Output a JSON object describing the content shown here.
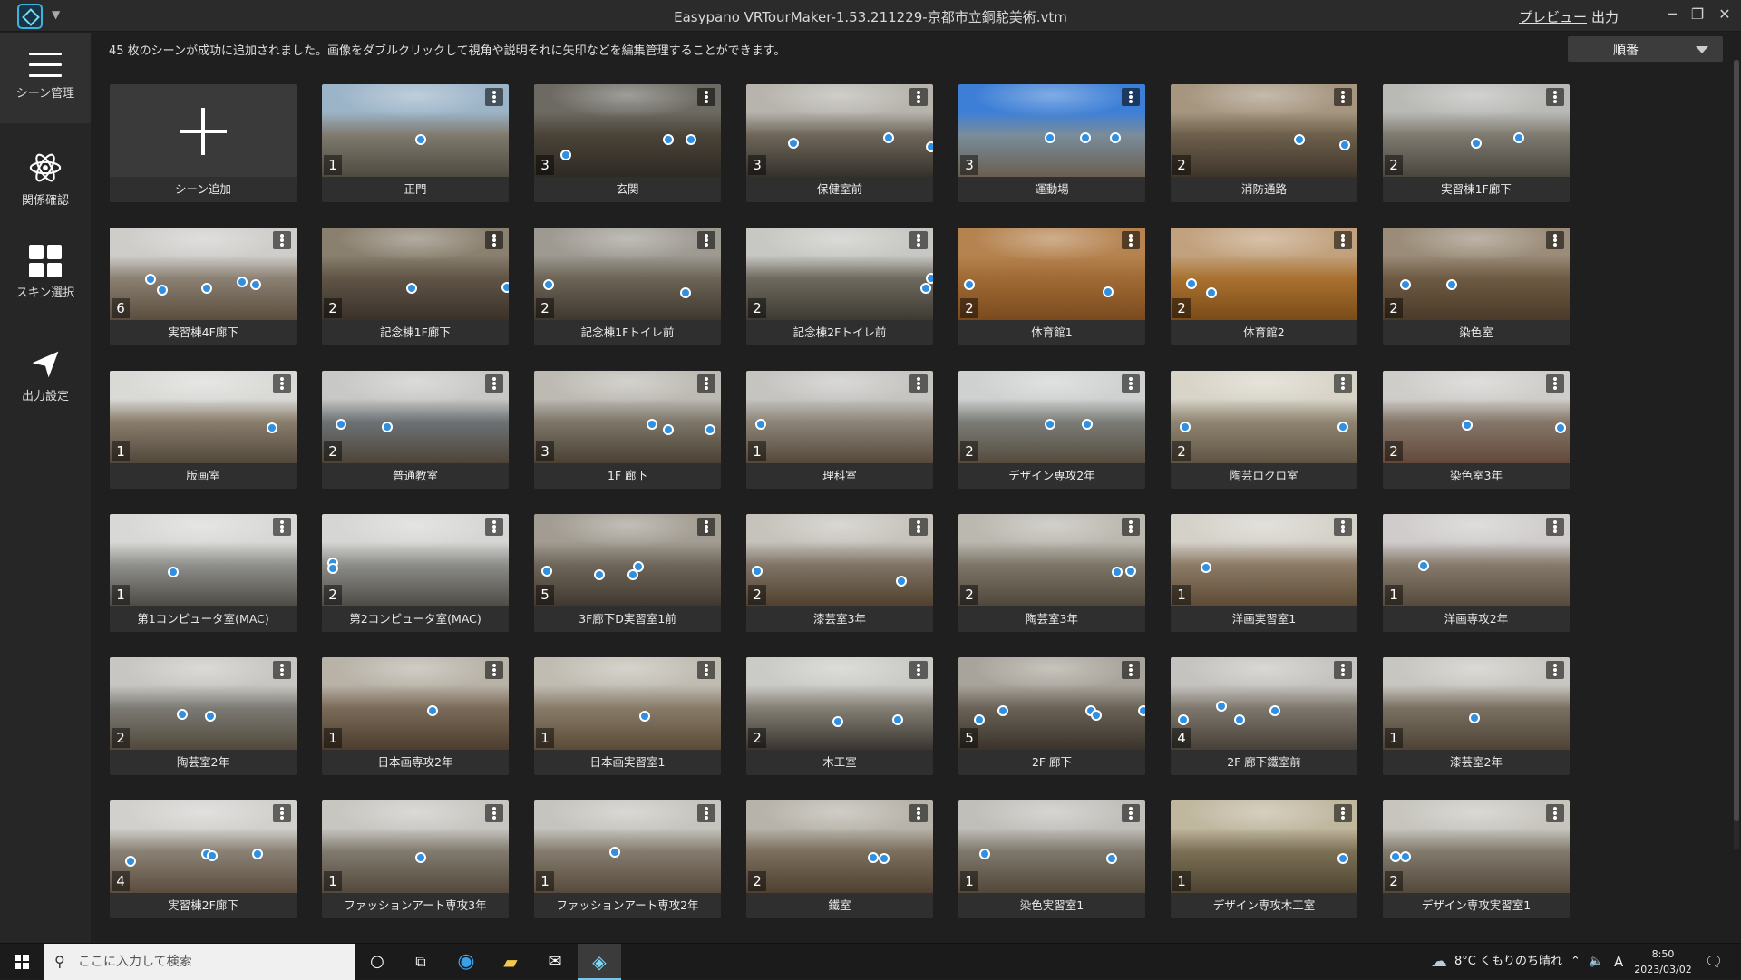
{
  "window": {
    "title": "Easypano VRTourMaker-1.53.211229-京都市立銅駝美術.vtm",
    "preview_link": "プレビュー",
    "output_link": "出力",
    "minimize": "─",
    "restore": "❐",
    "close": "✕"
  },
  "sidebar": {
    "items": [
      {
        "label": "シーン管理",
        "icon": "hamburger-icon"
      },
      {
        "label": "関係確認",
        "icon": "atom-icon"
      },
      {
        "label": "スキン選択",
        "icon": "grid-icon"
      },
      {
        "label": "出力設定",
        "icon": "send-arrow-icon"
      }
    ]
  },
  "main": {
    "message": "45 枚のシーンが成功に追加されました。画像をダブルクリックして視角や説明それに矢印などを編集管理することができます。",
    "sort_label": "順番",
    "add_scene_label": "シーン追加"
  },
  "scenes": [
    {
      "name": "正門",
      "count": "1",
      "hotspots": [
        [
          0.53,
          0.6
        ]
      ],
      "colors": [
        "#9cb4c8",
        "#7f7a6e",
        "#4f4a40"
      ]
    },
    {
      "name": "玄関",
      "count": "3",
      "hotspots": [
        [
          0.17,
          0.76
        ],
        [
          0.72,
          0.6
        ],
        [
          0.84,
          0.6
        ]
      ],
      "colors": [
        "#6d6a63",
        "#4a4338",
        "#2e2a24"
      ]
    },
    {
      "name": "保健室前",
      "count": "3",
      "hotspots": [
        [
          0.25,
          0.64
        ],
        [
          0.76,
          0.58
        ],
        [
          0.99,
          0.68
        ]
      ],
      "colors": [
        "#b7b4ad",
        "#6e665a",
        "#35312b"
      ]
    },
    {
      "name": "運動場",
      "count": "3",
      "hotspots": [
        [
          0.49,
          0.58
        ],
        [
          0.68,
          0.58
        ],
        [
          0.84,
          0.58
        ]
      ],
      "colors": [
        "#3d7fd6",
        "#7a8c9a",
        "#6a5f50"
      ]
    },
    {
      "name": "消防通路",
      "count": "2",
      "hotspots": [
        [
          0.69,
          0.6
        ],
        [
          0.93,
          0.66
        ]
      ],
      "colors": [
        "#a69680",
        "#6d5f4b",
        "#3e352a"
      ]
    },
    {
      "name": "実習棟1F廊下",
      "count": "2",
      "hotspots": [
        [
          0.5,
          0.64
        ],
        [
          0.73,
          0.58
        ]
      ],
      "colors": [
        "#b9b9b6",
        "#7f7a70",
        "#4a453e"
      ]
    },
    {
      "name": "実習棟4F廊下",
      "count": "6",
      "hotspots": [
        [
          0.22,
          0.56
        ],
        [
          0.28,
          0.68
        ],
        [
          0.52,
          0.66
        ],
        [
          0.71,
          0.59
        ],
        [
          0.78,
          0.62
        ]
      ],
      "colors": [
        "#cfcdca",
        "#8b8072",
        "#5a4d3e"
      ]
    },
    {
      "name": "記念棟1F廊下",
      "count": "2",
      "hotspots": [
        [
          0.48,
          0.66
        ],
        [
          0.99,
          0.65
        ]
      ],
      "colors": [
        "#8a806f",
        "#5f5446",
        "#3a3129"
      ]
    },
    {
      "name": "記念棟1Fトイレ前",
      "count": "2",
      "hotspots": [
        [
          0.08,
          0.62
        ],
        [
          0.81,
          0.71
        ]
      ],
      "colors": [
        "#9e9a92",
        "#6c6455",
        "#3f382f"
      ]
    },
    {
      "name": "記念棟2Fトイレ前",
      "count": "2",
      "hotspots": [
        [
          0.96,
          0.66
        ],
        [
          0.99,
          0.55
        ]
      ],
      "colors": [
        "#c7c7c3",
        "#6f6a5e",
        "#3d3a33"
      ]
    },
    {
      "name": "体育館1",
      "count": "2",
      "hotspots": [
        [
          0.06,
          0.62
        ],
        [
          0.8,
          0.7
        ]
      ],
      "colors": [
        "#b58350",
        "#a06a34",
        "#7a4a1e"
      ]
    },
    {
      "name": "体育館2",
      "count": "2",
      "hotspots": [
        [
          0.11,
          0.61
        ],
        [
          0.22,
          0.71
        ]
      ],
      "colors": [
        "#c2a27e",
        "#a8712f",
        "#7b4b18"
      ]
    },
    {
      "name": "染色室",
      "count": "2",
      "hotspots": [
        [
          0.12,
          0.62
        ],
        [
          0.37,
          0.62
        ]
      ],
      "colors": [
        "#9a8c78",
        "#6e5a43",
        "#4a3a29"
      ]
    },
    {
      "name": "版画室",
      "count": "1",
      "hotspots": [
        [
          0.87,
          0.62
        ]
      ],
      "colors": [
        "#d9d9d6",
        "#8a7e6d",
        "#51473a"
      ]
    },
    {
      "name": "普通教室",
      "count": "2",
      "hotspots": [
        [
          0.1,
          0.58
        ],
        [
          0.35,
          0.61
        ]
      ],
      "colors": [
        "#c8c8c6",
        "#6d7275",
        "#4d4437"
      ]
    },
    {
      "name": "1F 廊下",
      "count": "3",
      "hotspots": [
        [
          0.63,
          0.58
        ],
        [
          0.72,
          0.64
        ],
        [
          0.94,
          0.64
        ]
      ],
      "colors": [
        "#bdbab3",
        "#7d7669",
        "#4a4034"
      ]
    },
    {
      "name": "理科室",
      "count": "1",
      "hotspots": [
        [
          0.08,
          0.58
        ]
      ],
      "colors": [
        "#c5c4c1",
        "#8d8579",
        "#54483a"
      ]
    },
    {
      "name": "デザイン専攻2年",
      "count": "2",
      "hotspots": [
        [
          0.49,
          0.58
        ],
        [
          0.69,
          0.58
        ]
      ],
      "colors": [
        "#cfd1d0",
        "#7b7d78",
        "#554b3d"
      ]
    },
    {
      "name": "陶芸ロクロ室",
      "count": "2",
      "hotspots": [
        [
          0.08,
          0.61
        ],
        [
          0.92,
          0.61
        ]
      ],
      "colors": [
        "#d8d4c8",
        "#8f8572",
        "#5f5443"
      ]
    },
    {
      "name": "染色室3年",
      "count": "2",
      "hotspots": [
        [
          0.45,
          0.59
        ],
        [
          0.95,
          0.62
        ]
      ],
      "colors": [
        "#cfcdca",
        "#85776a",
        "#62493a"
      ]
    },
    {
      "name": "第1コンピュータ室(MAC)",
      "count": "1",
      "hotspots": [
        [
          0.34,
          0.63
        ]
      ],
      "colors": [
        "#d8d8d6",
        "#8f8f8b",
        "#4d4a44"
      ]
    },
    {
      "name": "第2コンピュータ室(MAC)",
      "count": "2",
      "hotspots": [
        [
          0.06,
          0.53
        ],
        [
          0.06,
          0.59
        ]
      ],
      "colors": [
        "#d6d6d4",
        "#8c8c88",
        "#4e4b45"
      ]
    },
    {
      "name": "3F廊下D実習室1前",
      "count": "5",
      "hotspots": [
        [
          0.07,
          0.62
        ],
        [
          0.35,
          0.66
        ],
        [
          0.53,
          0.66
        ],
        [
          0.56,
          0.57
        ]
      ],
      "colors": [
        "#a29c92",
        "#6f665a",
        "#40382f"
      ]
    },
    {
      "name": "漆芸室3年",
      "count": "2",
      "hotspots": [
        [
          0.06,
          0.62
        ],
        [
          0.83,
          0.73
        ]
      ],
      "colors": [
        "#c6c3bc",
        "#7f7466",
        "#513f2e"
      ]
    },
    {
      "name": "陶芸室3年",
      "count": "2",
      "hotspots": [
        [
          0.85,
          0.63
        ],
        [
          0.92,
          0.62
        ]
      ],
      "colors": [
        "#bbb8b0",
        "#7d7668",
        "#4e463a"
      ]
    },
    {
      "name": "洋画実習室1",
      "count": "1",
      "hotspots": [
        [
          0.19,
          0.58
        ]
      ],
      "colors": [
        "#d4d1c9",
        "#8c7b66",
        "#5c4a35"
      ]
    },
    {
      "name": "洋画専攻2年",
      "count": "1",
      "hotspots": [
        [
          0.22,
          0.56
        ]
      ],
      "colors": [
        "#cfcccb",
        "#857a6c",
        "#55493c"
      ]
    },
    {
      "name": "陶芸室2年",
      "count": "2",
      "hotspots": [
        [
          0.39,
          0.62
        ],
        [
          0.54,
          0.64
        ]
      ],
      "colors": [
        "#c7c6c2",
        "#7b7a74",
        "#52483b"
      ]
    },
    {
      "name": "日本画専攻2年",
      "count": "1",
      "hotspots": [
        [
          0.59,
          0.58
        ]
      ],
      "colors": [
        "#b8b2a7",
        "#7a6a59",
        "#4d3d2e"
      ]
    },
    {
      "name": "日本画実習室1",
      "count": "1",
      "hotspots": [
        [
          0.59,
          0.64
        ]
      ],
      "colors": [
        "#c0bcb2",
        "#887b68",
        "#5a4b38"
      ]
    },
    {
      "name": "木工室",
      "count": "2",
      "hotspots": [
        [
          0.49,
          0.7
        ],
        [
          0.81,
          0.68
        ]
      ],
      "colors": [
        "#cacac6",
        "#847f75",
        "#3a3530"
      ]
    },
    {
      "name": "2F 廊下",
      "count": "5",
      "hotspots": [
        [
          0.11,
          0.68
        ],
        [
          0.24,
          0.58
        ],
        [
          0.71,
          0.58
        ],
        [
          0.74,
          0.63
        ],
        [
          0.99,
          0.58
        ]
      ],
      "colors": [
        "#a9a49b",
        "#6a6256",
        "#3a332b"
      ]
    },
    {
      "name": "2F 廊下鐵室前",
      "count": "4",
      "hotspots": [
        [
          0.07,
          0.68
        ],
        [
          0.27,
          0.53
        ],
        [
          0.37,
          0.68
        ],
        [
          0.56,
          0.58
        ]
      ],
      "colors": [
        "#c5c3bf",
        "#7e776d",
        "#464038"
      ]
    },
    {
      "name": "漆芸室2年",
      "count": "1",
      "hotspots": [
        [
          0.49,
          0.66
        ]
      ],
      "colors": [
        "#c8c6c0",
        "#7a7062",
        "#4e4335"
      ]
    },
    {
      "name": "実習棟2F廊下",
      "count": "4",
      "hotspots": [
        [
          0.11,
          0.66
        ],
        [
          0.52,
          0.58
        ],
        [
          0.55,
          0.6
        ],
        [
          0.79,
          0.58
        ]
      ],
      "colors": [
        "#d1d0cd",
        "#8a8175",
        "#5b4d3e"
      ]
    },
    {
      "name": "ファッションアート専攻3年",
      "count": "1",
      "hotspots": [
        [
          0.53,
          0.62
        ]
      ],
      "colors": [
        "#c7c6c1",
        "#817a6e",
        "#53493c"
      ]
    },
    {
      "name": "ファッションアート専攻2年",
      "count": "1",
      "hotspots": [
        [
          0.43,
          0.56
        ]
      ],
      "colors": [
        "#c6c4be",
        "#857c6f",
        "#564a3b"
      ]
    },
    {
      "name": "鐵室",
      "count": "2",
      "hotspots": [
        [
          0.68,
          0.62
        ],
        [
          0.74,
          0.63
        ]
      ],
      "colors": [
        "#b7b3aa",
        "#7c6f5d",
        "#4f4131"
      ]
    },
    {
      "name": "染色実習室1",
      "count": "1",
      "hotspots": [
        [
          0.14,
          0.58
        ],
        [
          0.82,
          0.63
        ]
      ],
      "colors": [
        "#c1bfba",
        "#7e786c",
        "#52483a"
      ]
    },
    {
      "name": "デザイン専攻木工室",
      "count": "1",
      "hotspots": [
        [
          0.92,
          0.63
        ]
      ],
      "colors": [
        "#c0b79f",
        "#7c7055",
        "#4d4330"
      ]
    },
    {
      "name": "デザイン専攻実習室1",
      "count": "2",
      "hotspots": [
        [
          0.07,
          0.61
        ],
        [
          0.12,
          0.61
        ]
      ],
      "colors": [
        "#c7c5be",
        "#827a6d",
        "#53493b"
      ]
    }
  ],
  "taskbar": {
    "search_placeholder": "ここに入力して検索",
    "weather": "8°C くもりのち晴れ",
    "time": "8:50",
    "date": "2023/03/02",
    "ime": "A"
  }
}
